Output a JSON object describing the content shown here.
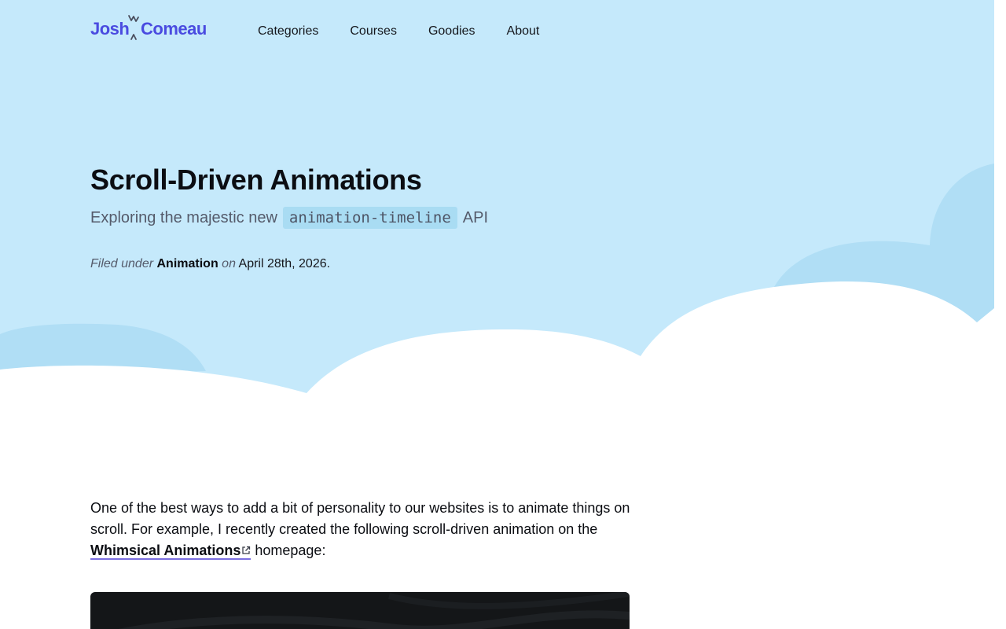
{
  "header": {
    "logo": {
      "first": "Josh",
      "last": "Comeau"
    },
    "nav": [
      {
        "label": "Categories"
      },
      {
        "label": "Courses"
      },
      {
        "label": "Goodies"
      },
      {
        "label": "About"
      }
    ]
  },
  "post": {
    "title": "Scroll-Driven Animations",
    "subtitle": {
      "before": "Exploring the majestic new",
      "code": "animation-timeline",
      "after": "API"
    },
    "meta": {
      "filed_under": "Filed under",
      "category": "Animation",
      "on": "on",
      "date": "April 28th, 2026."
    }
  },
  "body": {
    "intro_before": "One of the best ways to add a bit of personality to our websites is to animate things on scroll. For example, I recently created the following scroll-driven animation on the ",
    "link_label": "Whimsical Animations",
    "intro_after": " homepage:"
  },
  "colors": {
    "brand": "#4a4be0",
    "hero_sky": "#c5e9fb",
    "cloud_back": "#b0def5",
    "link_underline": "#7b6fe0",
    "demo_bg": "#141618"
  },
  "icons": {
    "external_link": "external-link-icon",
    "logo_mark": "logo-spark-icon"
  }
}
